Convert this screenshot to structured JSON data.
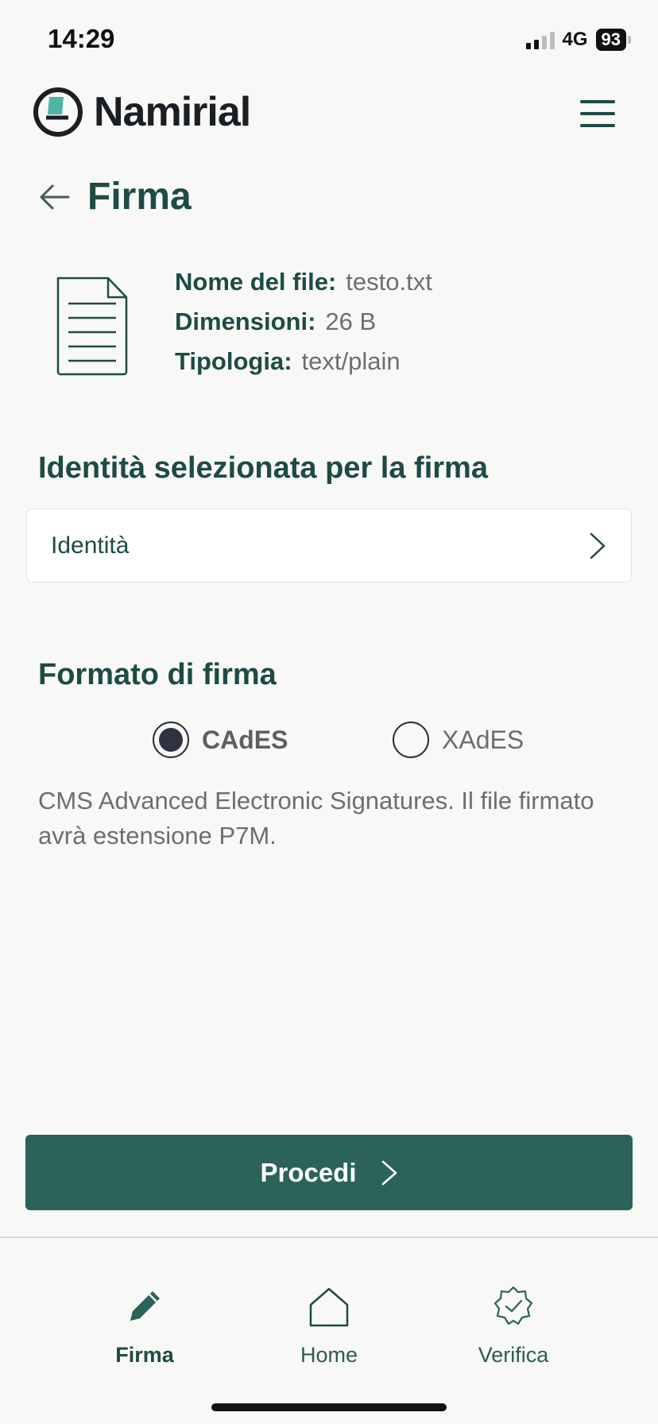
{
  "status_bar": {
    "time": "14:29",
    "network": "4G",
    "battery": "93"
  },
  "header": {
    "logo_text": "Namirial"
  },
  "page": {
    "title": "Firma"
  },
  "file": {
    "rows": [
      {
        "label": "Nome del file:",
        "value": "testo.txt"
      },
      {
        "label": "Dimensioni:",
        "value": "26 B"
      },
      {
        "label": "Tipologia:",
        "value": "text/plain"
      }
    ]
  },
  "identity": {
    "section_title": "Identità selezionata per la firma",
    "label": "Identità"
  },
  "format": {
    "section_title": "Formato di firma",
    "options": [
      {
        "label": "CAdES",
        "selected": true
      },
      {
        "label": "XAdES",
        "selected": false
      }
    ],
    "description": "CMS Advanced Electronic Signatures. Il file firmato avrà estensione P7M."
  },
  "actions": {
    "proceed_label": "Procedi"
  },
  "tabs": [
    {
      "label": "Firma",
      "icon": "pencil-icon",
      "active": true
    },
    {
      "label": "Home",
      "icon": "home-icon",
      "active": false
    },
    {
      "label": "Verifica",
      "icon": "verified-badge-icon",
      "active": false
    }
  ],
  "colors": {
    "primary": "#2b6259",
    "text_primary": "#1d4b45",
    "text_secondary": "#6b6f70",
    "background": "#f8f8f6",
    "logo_accent": "#4fb3a6"
  }
}
